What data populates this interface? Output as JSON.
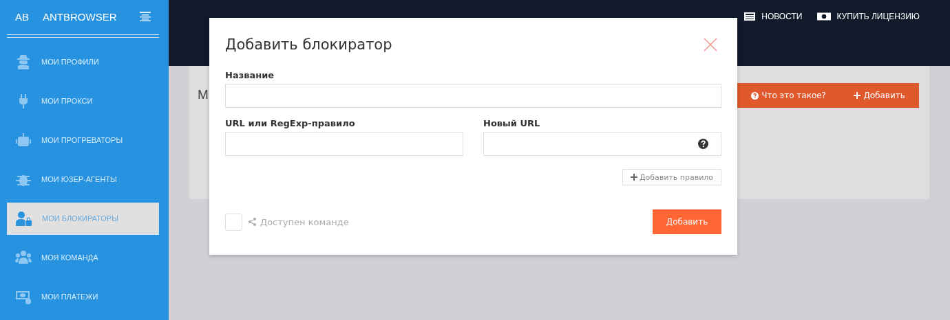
{
  "sidebar": {
    "logo": "AB",
    "brand": "ANTBROWSER",
    "items": [
      {
        "label": "МОИ ПРОФИЛИ",
        "selected": false
      },
      {
        "label": "МОИ ПРОКСИ",
        "selected": false
      },
      {
        "label": "МОИ ПРОГРЕВАТОРЫ",
        "selected": false
      },
      {
        "label": "МОИ ЮЗЕР-АГЕНТЫ",
        "selected": false
      },
      {
        "label": "МОИ БЛОКИРАТОРЫ",
        "selected": true
      },
      {
        "label": "МОЯ КОМАНДА",
        "selected": false
      },
      {
        "label": "МОИ ПЛАТЕЖИ",
        "selected": false
      }
    ]
  },
  "top_nav": [
    {
      "label": "НОВОСТИ"
    },
    {
      "label": "КУПИТЬ ЛИЦЕНЗИЮ"
    }
  ],
  "card": {
    "title": "М",
    "help_button": "Что это такое?",
    "add_button": "Добавить"
  },
  "modal": {
    "title": "Добавить блокиратор",
    "name_field": {
      "label": "Название"
    },
    "rule_fields": [
      {
        "label": "URL или RegExp-правило",
        "kind": "plain"
      },
      {
        "label": "Новый URL",
        "kind": "help"
      }
    ],
    "add_rule_button": "Добавить правило",
    "shared": {
      "label": "Доступен команде",
      "checked": false
    },
    "submit_button": "Добавить"
  }
}
